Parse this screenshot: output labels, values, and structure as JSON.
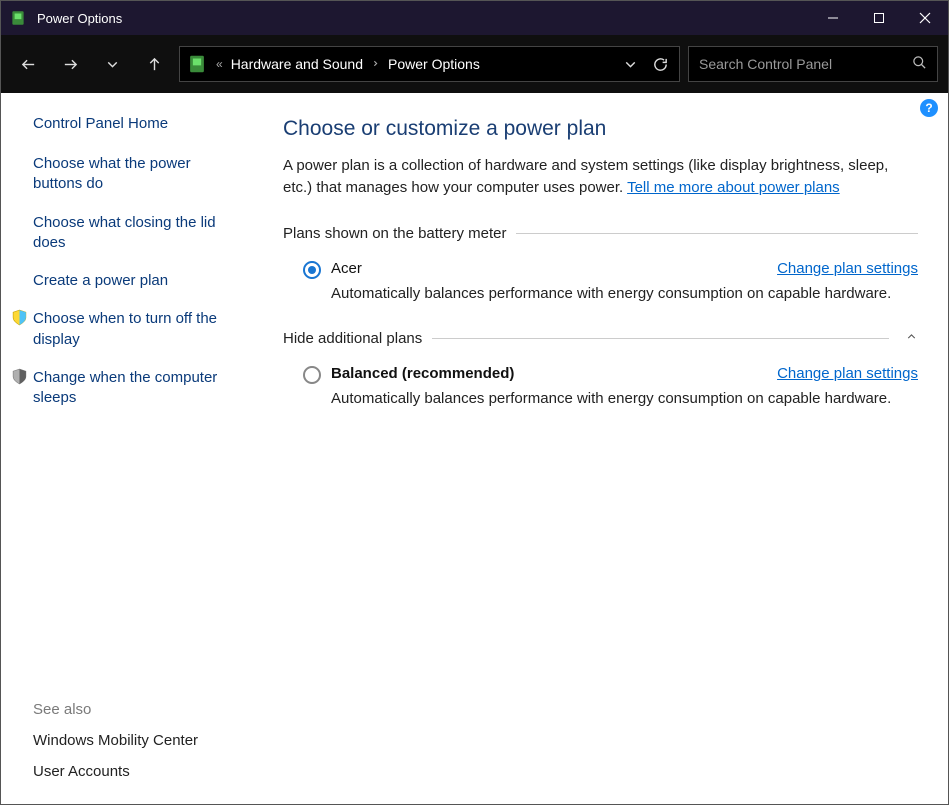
{
  "window": {
    "title": "Power Options",
    "help_badge": "?"
  },
  "breadcrumb": {
    "prefix": "«",
    "parent": "Hardware and Sound",
    "current": "Power Options"
  },
  "search": {
    "placeholder": "Search Control Panel"
  },
  "sidebar": {
    "home": "Control Panel Home",
    "items": [
      {
        "label": "Choose what the power buttons do"
      },
      {
        "label": "Choose what closing the lid does"
      },
      {
        "label": "Create a power plan"
      },
      {
        "label": "Choose when to turn off the display"
      },
      {
        "label": "Change when the computer sleeps"
      }
    ],
    "see_also_label": "See also",
    "see_also": [
      {
        "label": "Windows Mobility Center"
      },
      {
        "label": "User Accounts"
      }
    ]
  },
  "main": {
    "title": "Choose or customize a power plan",
    "description_prefix": "A power plan is a collection of hardware and system settings (like display brightness, sleep, etc.) that manages how your computer uses power. ",
    "description_link": "Tell me more about power plans",
    "section1_label": "Plans shown on the battery meter",
    "section2_label": "Hide additional plans",
    "plans": [
      {
        "name": "Acer",
        "selected": true,
        "bold": false,
        "link": "Change plan settings",
        "desc": "Automatically balances performance with energy consumption on capable hardware."
      },
      {
        "name": "Balanced (recommended)",
        "selected": false,
        "bold": true,
        "link": "Change plan settings",
        "desc": "Automatically balances performance with energy consumption on capable hardware."
      }
    ]
  }
}
